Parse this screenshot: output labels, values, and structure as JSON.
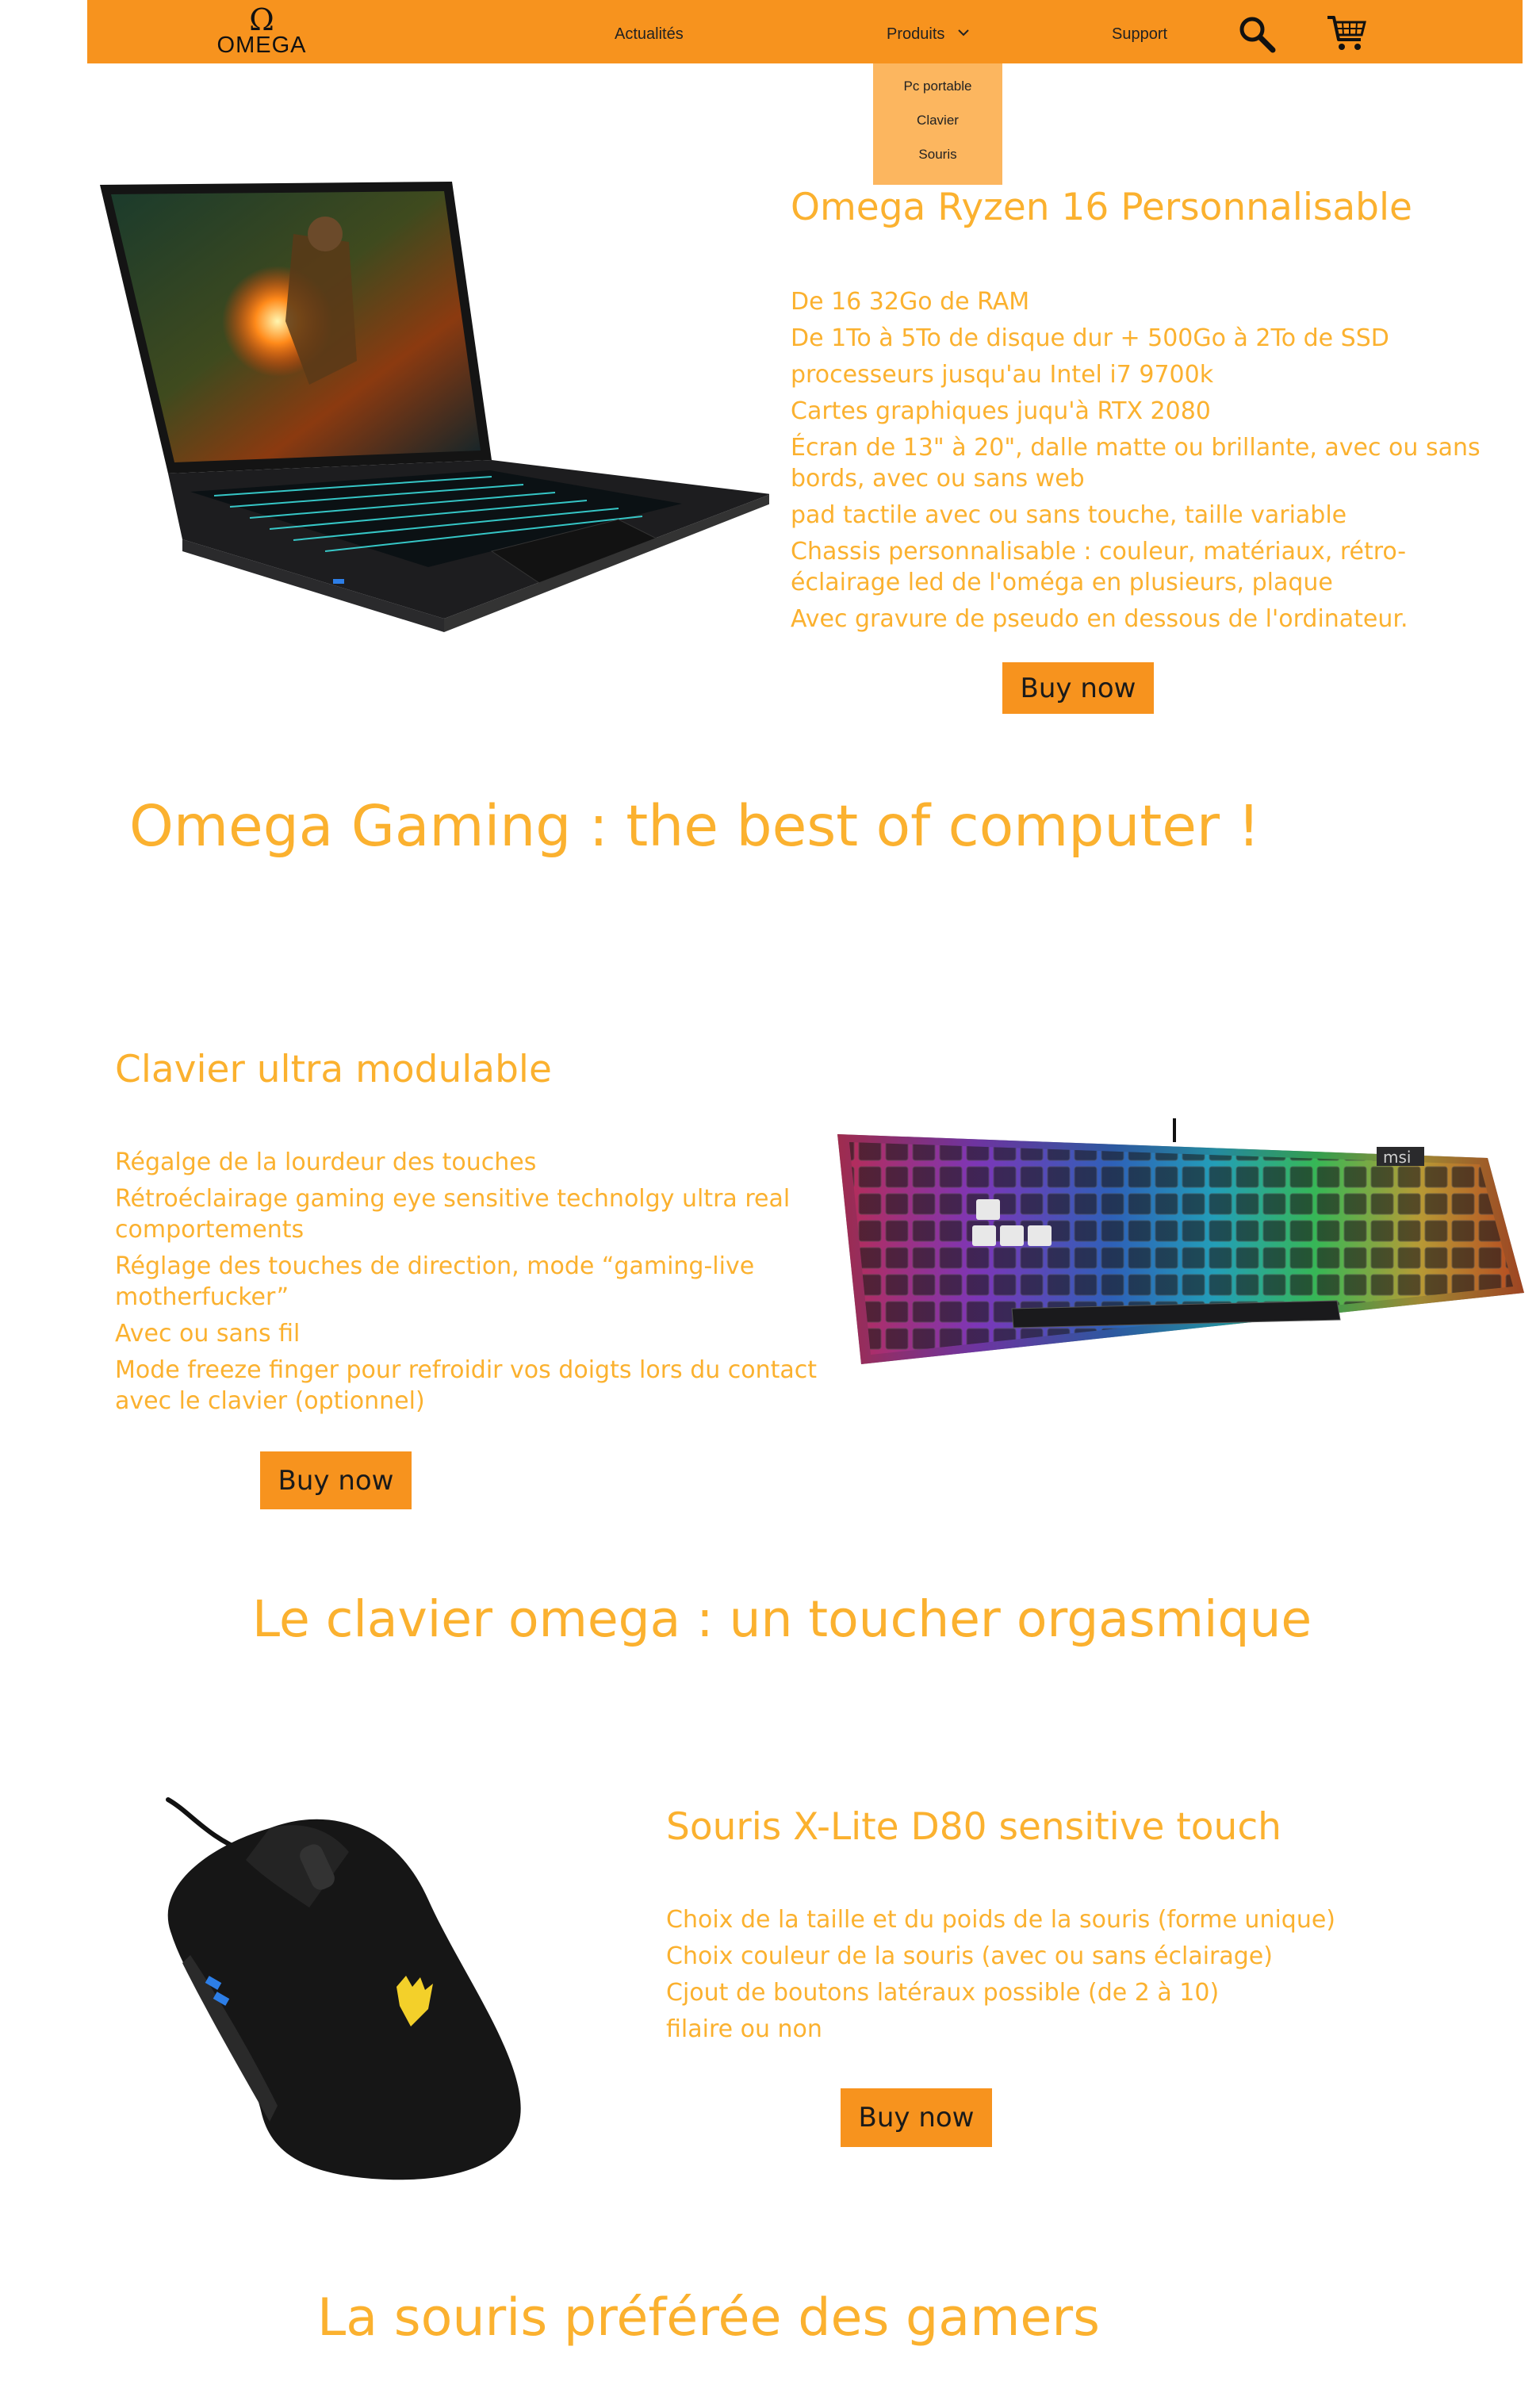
{
  "header": {
    "logo_symbol": "Ω",
    "logo_text": "OMEGA",
    "nav": {
      "actualites": "Actualités",
      "produits": "Produits",
      "support": "Support"
    },
    "icons": [
      "search-icon",
      "cart-icon",
      "chevron-down-icon"
    ]
  },
  "dropdown": {
    "items": [
      "Pc portable",
      "Clavier",
      "Souris"
    ]
  },
  "laptop": {
    "title": "Omega Ryzen 16 Personnalisable",
    "features": [
      "De 16  32Go de RAM",
      "De 1To à 5To de disque dur + 500Go à 2To de SSD",
      "processeurs jusqu'au Intel i7 9700k",
      "Cartes graphiques juqu'à RTX 2080",
      "Écran de 13\" à 20\", dalle matte ou brillante, avec ou sans bords, avec ou sans web",
      "pad tactile avec ou sans touche, taille variable",
      "Chassis personnalisable : couleur, matériaux, rétro-éclairage led de l'oméga en plusieurs, plaque",
      "Avec gravure de pseudo en dessous de l'ordinateur."
    ],
    "buy_label": "Buy now"
  },
  "tagline1": "Omega Gaming : the best of computer !",
  "keyboard": {
    "title": "Clavier ultra modulable",
    "features": [
      "Régalge de la lourdeur des touches",
      "Rétroéclairage gaming eye sensitive technolgy ultra real comportements",
      "Réglage des touches de direction, mode “gaming-live motherfucker”",
      "Avec ou sans fil",
      "Mode freeze finger pour refroidir vos doigts lors du contact avec le clavier (optionnel)"
    ],
    "buy_label": "Buy now",
    "brand_badge": "msi"
  },
  "tagline2": "Le clavier omega : un toucher orgasmique",
  "mouse": {
    "title": "Souris X-Lite D80 sensitive touch",
    "features": [
      "Choix de la taille et du poids de la souris (forme unique)",
      "Choix couleur de la souris (avec ou sans éclairage)",
      "Cjout de boutons latéraux possible (de 2 à 10)",
      "filaire ou non"
    ],
    "buy_label": "Buy now"
  },
  "tagline3": "La souris préférée des gamers",
  "colors": {
    "nav_bg": "#F7931E",
    "dropdown_bg": "#FCB65F",
    "text_accent": "#FBB12F",
    "button_bg": "#F7931E"
  }
}
